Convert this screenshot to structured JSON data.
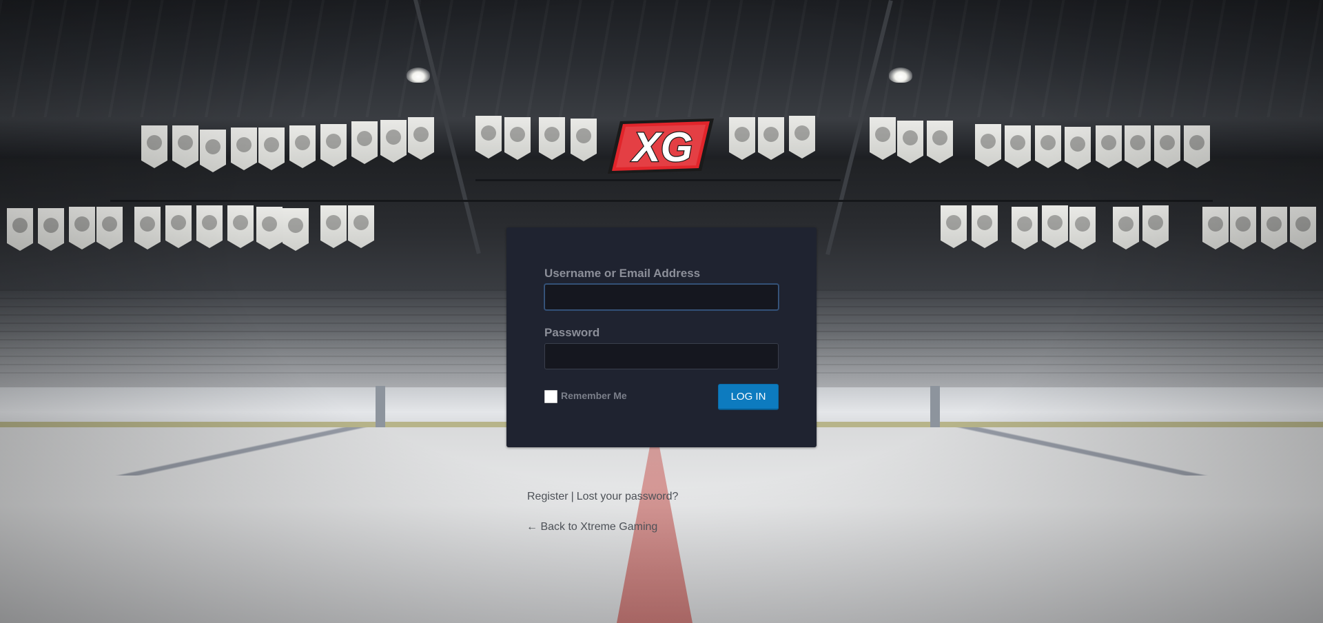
{
  "brand": {
    "logo_text": "XG",
    "logo_colors": {
      "red": "#e1252b",
      "white": "#ffffff",
      "outline": "#1a1a1a"
    }
  },
  "login_form": {
    "username_label": "Username or Email Address",
    "username_value": "",
    "password_label": "Password",
    "password_value": "",
    "remember_label": "Remember Me",
    "remember_checked": false,
    "submit_label": "LOG IN"
  },
  "links": {
    "register": "Register",
    "separator": "|",
    "lost_password": "Lost your password?",
    "back_to_site": "← Back to Xtreme Gaming"
  },
  "colors": {
    "card_bg": "#1f2330",
    "button_bg": "#0d7bbf",
    "label_text": "#8c8f99"
  }
}
